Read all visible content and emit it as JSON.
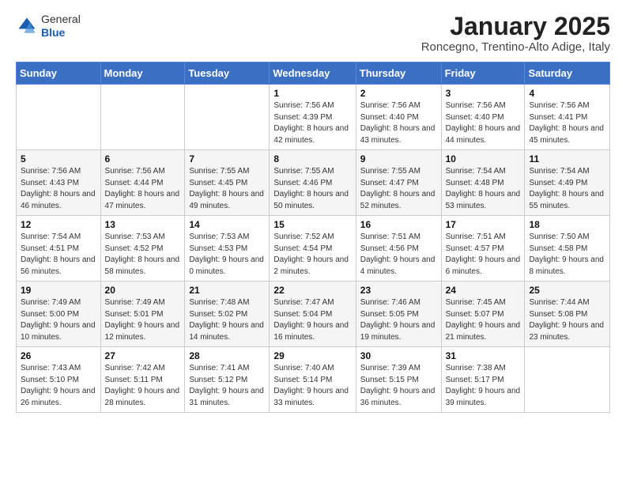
{
  "header": {
    "logo_general": "General",
    "logo_blue": "Blue",
    "month_title": "January 2025",
    "location": "Roncegno, Trentino-Alto Adige, Italy"
  },
  "weekdays": [
    "Sunday",
    "Monday",
    "Tuesday",
    "Wednesday",
    "Thursday",
    "Friday",
    "Saturday"
  ],
  "weeks": [
    [
      {
        "day": "",
        "info": ""
      },
      {
        "day": "",
        "info": ""
      },
      {
        "day": "",
        "info": ""
      },
      {
        "day": "1",
        "info": "Sunrise: 7:56 AM\nSunset: 4:39 PM\nDaylight: 8 hours and 42 minutes."
      },
      {
        "day": "2",
        "info": "Sunrise: 7:56 AM\nSunset: 4:40 PM\nDaylight: 8 hours and 43 minutes."
      },
      {
        "day": "3",
        "info": "Sunrise: 7:56 AM\nSunset: 4:40 PM\nDaylight: 8 hours and 44 minutes."
      },
      {
        "day": "4",
        "info": "Sunrise: 7:56 AM\nSunset: 4:41 PM\nDaylight: 8 hours and 45 minutes."
      }
    ],
    [
      {
        "day": "5",
        "info": "Sunrise: 7:56 AM\nSunset: 4:43 PM\nDaylight: 8 hours and 46 minutes."
      },
      {
        "day": "6",
        "info": "Sunrise: 7:56 AM\nSunset: 4:44 PM\nDaylight: 8 hours and 47 minutes."
      },
      {
        "day": "7",
        "info": "Sunrise: 7:55 AM\nSunset: 4:45 PM\nDaylight: 8 hours and 49 minutes."
      },
      {
        "day": "8",
        "info": "Sunrise: 7:55 AM\nSunset: 4:46 PM\nDaylight: 8 hours and 50 minutes."
      },
      {
        "day": "9",
        "info": "Sunrise: 7:55 AM\nSunset: 4:47 PM\nDaylight: 8 hours and 52 minutes."
      },
      {
        "day": "10",
        "info": "Sunrise: 7:54 AM\nSunset: 4:48 PM\nDaylight: 8 hours and 53 minutes."
      },
      {
        "day": "11",
        "info": "Sunrise: 7:54 AM\nSunset: 4:49 PM\nDaylight: 8 hours and 55 minutes."
      }
    ],
    [
      {
        "day": "12",
        "info": "Sunrise: 7:54 AM\nSunset: 4:51 PM\nDaylight: 8 hours and 56 minutes."
      },
      {
        "day": "13",
        "info": "Sunrise: 7:53 AM\nSunset: 4:52 PM\nDaylight: 8 hours and 58 minutes."
      },
      {
        "day": "14",
        "info": "Sunrise: 7:53 AM\nSunset: 4:53 PM\nDaylight: 9 hours and 0 minutes."
      },
      {
        "day": "15",
        "info": "Sunrise: 7:52 AM\nSunset: 4:54 PM\nDaylight: 9 hours and 2 minutes."
      },
      {
        "day": "16",
        "info": "Sunrise: 7:51 AM\nSunset: 4:56 PM\nDaylight: 9 hours and 4 minutes."
      },
      {
        "day": "17",
        "info": "Sunrise: 7:51 AM\nSunset: 4:57 PM\nDaylight: 9 hours and 6 minutes."
      },
      {
        "day": "18",
        "info": "Sunrise: 7:50 AM\nSunset: 4:58 PM\nDaylight: 9 hours and 8 minutes."
      }
    ],
    [
      {
        "day": "19",
        "info": "Sunrise: 7:49 AM\nSunset: 5:00 PM\nDaylight: 9 hours and 10 minutes."
      },
      {
        "day": "20",
        "info": "Sunrise: 7:49 AM\nSunset: 5:01 PM\nDaylight: 9 hours and 12 minutes."
      },
      {
        "day": "21",
        "info": "Sunrise: 7:48 AM\nSunset: 5:02 PM\nDaylight: 9 hours and 14 minutes."
      },
      {
        "day": "22",
        "info": "Sunrise: 7:47 AM\nSunset: 5:04 PM\nDaylight: 9 hours and 16 minutes."
      },
      {
        "day": "23",
        "info": "Sunrise: 7:46 AM\nSunset: 5:05 PM\nDaylight: 9 hours and 19 minutes."
      },
      {
        "day": "24",
        "info": "Sunrise: 7:45 AM\nSunset: 5:07 PM\nDaylight: 9 hours and 21 minutes."
      },
      {
        "day": "25",
        "info": "Sunrise: 7:44 AM\nSunset: 5:08 PM\nDaylight: 9 hours and 23 minutes."
      }
    ],
    [
      {
        "day": "26",
        "info": "Sunrise: 7:43 AM\nSunset: 5:10 PM\nDaylight: 9 hours and 26 minutes."
      },
      {
        "day": "27",
        "info": "Sunrise: 7:42 AM\nSunset: 5:11 PM\nDaylight: 9 hours and 28 minutes."
      },
      {
        "day": "28",
        "info": "Sunrise: 7:41 AM\nSunset: 5:12 PM\nDaylight: 9 hours and 31 minutes."
      },
      {
        "day": "29",
        "info": "Sunrise: 7:40 AM\nSunset: 5:14 PM\nDaylight: 9 hours and 33 minutes."
      },
      {
        "day": "30",
        "info": "Sunrise: 7:39 AM\nSunset: 5:15 PM\nDaylight: 9 hours and 36 minutes."
      },
      {
        "day": "31",
        "info": "Sunrise: 7:38 AM\nSunset: 5:17 PM\nDaylight: 9 hours and 39 minutes."
      },
      {
        "day": "",
        "info": ""
      }
    ]
  ]
}
